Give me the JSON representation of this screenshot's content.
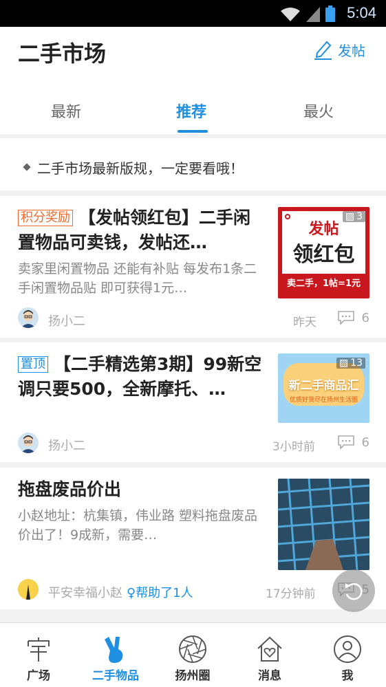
{
  "status_bar": {
    "time": "5:04"
  },
  "header": {
    "title": "二手市场",
    "post_label": "发帖"
  },
  "tabs": [
    {
      "label": "最新",
      "active": false
    },
    {
      "label": "推荐",
      "active": true
    },
    {
      "label": "最火",
      "active": false
    }
  ],
  "notice": {
    "text": "二手市场最新版规，一定要看哦！"
  },
  "posts": [
    {
      "tag": "积分奖励",
      "title": "【发帖领红包】二手闲置物品可卖钱，发帖还…",
      "summary": "卖家里闲置物品 还能有补贴 每发布1条二手闲置物品贴 即可获得1元…",
      "image_count": "3",
      "image_text": {
        "line1": "发帖",
        "line2": "领红包",
        "line3": "卖二手，1帖=1元"
      },
      "author": "扬小二",
      "time": "昨天",
      "comments": "6"
    },
    {
      "tag": "置顶",
      "title": "【二手精选第3期】99新空调只要500，全新摩托、…",
      "image_count": "13",
      "image_text": {
        "line1": "新二手商品汇",
        "line2": "优质好货尽在扬州生活圈"
      },
      "author": "扬小二",
      "time": "3小时前",
      "comments": "6"
    },
    {
      "title": "拖盘废品价出",
      "summary": "小赵地址：杭集镇，伟业路 塑料拖盘废品价出了！9成新，需要…",
      "author": "平安幸福小赵",
      "helped": "帮助了1人",
      "time": "17分钟前",
      "comments": "5"
    }
  ],
  "bottom_nav": [
    {
      "label": "广场",
      "icon": "square-icon"
    },
    {
      "label": "二手物品",
      "icon": "victory-hand-icon",
      "active": true
    },
    {
      "label": "扬州圈",
      "icon": "aperture-icon"
    },
    {
      "label": "消息",
      "icon": "house-heart-icon"
    },
    {
      "label": "我",
      "icon": "user-icon"
    }
  ],
  "colors": {
    "accent": "#1e8fe1",
    "tag_orange": "#f26a2b"
  }
}
